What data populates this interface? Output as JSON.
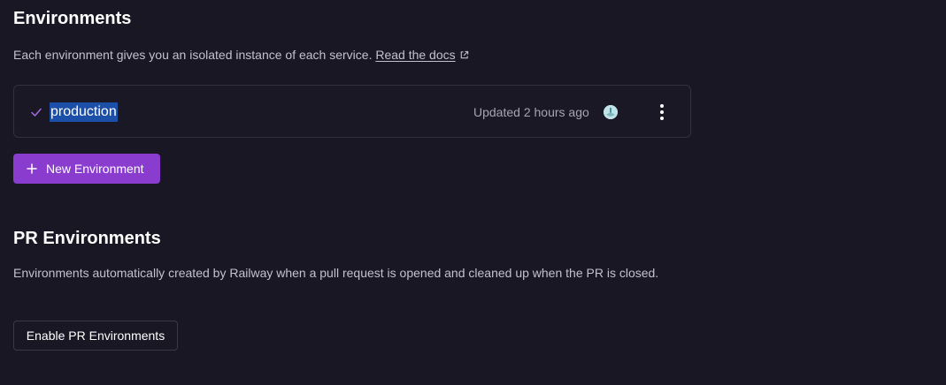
{
  "environments": {
    "title": "Environments",
    "description": "Each environment gives you an isolated instance of each service.",
    "docs_link": "Read the docs",
    "items": [
      {
        "name": "production",
        "updated": "Updated 2 hours ago"
      }
    ],
    "new_button": "New Environment"
  },
  "pr_environments": {
    "title": "PR Environments",
    "description": "Environments automatically created by Railway when a pull request is opened and cleaned up when the PR is closed.",
    "enable_button": "Enable PR Environments"
  },
  "icons": {
    "check": "check-icon",
    "external_link": "external-link-icon",
    "avatar": "user-avatar",
    "menu": "kebab-menu-icon",
    "plus": "plus-icon"
  },
  "colors": {
    "background": "#191724",
    "accent": "#8a3ccf",
    "check": "#a46be0",
    "selection": "#1c4fa8"
  }
}
